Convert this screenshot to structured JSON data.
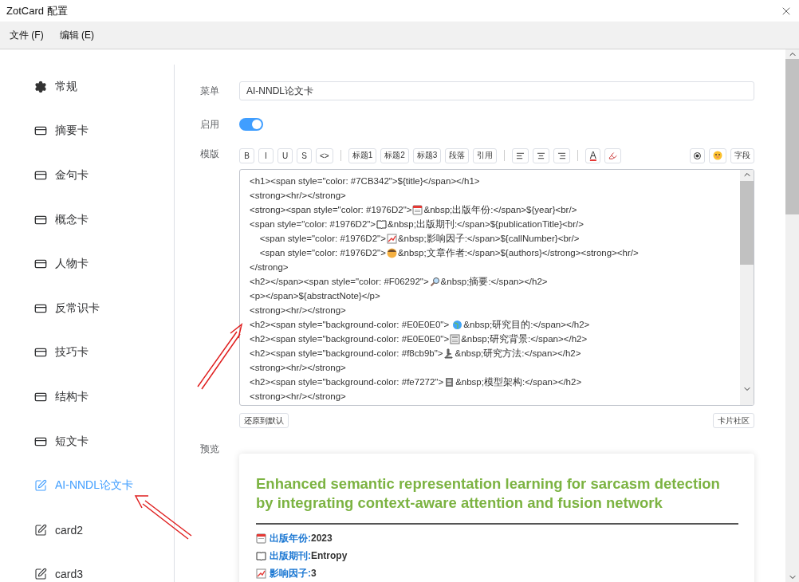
{
  "window": {
    "title": "ZotCard 配置"
  },
  "menu": [
    "文件 (F)",
    "编辑 (E)"
  ],
  "sidebar": {
    "items": [
      {
        "label": "常规",
        "kind": "settings",
        "selected": false
      },
      {
        "label": "摘要卡",
        "kind": "card",
        "selected": false
      },
      {
        "label": "金句卡",
        "kind": "card",
        "selected": false
      },
      {
        "label": "概念卡",
        "kind": "card",
        "selected": false
      },
      {
        "label": "人物卡",
        "kind": "card",
        "selected": false
      },
      {
        "label": "反常识卡",
        "kind": "card",
        "selected": false
      },
      {
        "label": "技巧卡",
        "kind": "card",
        "selected": false
      },
      {
        "label": "结构卡",
        "kind": "card",
        "selected": false
      },
      {
        "label": "短文卡",
        "kind": "card",
        "selected": false
      },
      {
        "label": "AI-NNDL论文卡",
        "kind": "custom",
        "selected": true
      },
      {
        "label": "card2",
        "kind": "custom",
        "selected": false
      },
      {
        "label": "card3",
        "kind": "custom",
        "selected": false
      }
    ]
  },
  "form": {
    "menu_label": "菜单",
    "menu_value": "AI-NNDL论文卡",
    "enabled_label": "启用",
    "enabled": true,
    "template_label": "模版",
    "preview_label": "预览"
  },
  "toolbar": {
    "groups": [
      [
        {
          "kind": "text",
          "label": "B"
        },
        {
          "kind": "text",
          "label": "I"
        },
        {
          "kind": "text",
          "label": "U"
        },
        {
          "kind": "text",
          "label": "S"
        },
        {
          "kind": "text",
          "label": "<>"
        }
      ],
      [
        {
          "kind": "text",
          "label": "标题1"
        },
        {
          "kind": "text",
          "label": "标题2"
        },
        {
          "kind": "text",
          "label": "标题3"
        },
        {
          "kind": "text",
          "label": "段落"
        },
        {
          "kind": "text",
          "label": "引用"
        }
      ],
      [
        {
          "kind": "align-left"
        },
        {
          "kind": "align-center"
        },
        {
          "kind": "align-right"
        }
      ],
      [
        {
          "kind": "color",
          "label": "A"
        },
        {
          "kind": "highlight"
        }
      ]
    ],
    "right": [
      {
        "kind": "record"
      },
      {
        "kind": "emoji"
      },
      {
        "kind": "text",
        "label": "字段"
      }
    ]
  },
  "template_lines": [
    {
      "text": "<h1><span style=\"color: #7CB342\">${title}</span></h1>"
    },
    {
      "text": "<strong><hr/></strong>"
    },
    {
      "before": "<strong><span style=\"color: #1976D2\">",
      "after": "&nbsp;出版年份:</span>${year}<br/>"
    },
    {
      "before": "<span style=\"color: #1976D2\">",
      "after": "&nbsp;出版期刊:</span>${publicationTitle}<br/>"
    },
    {
      "before": "    <span style=\"color: #1976D2\">",
      "after": "&nbsp;影响因子:</span>${callNumber}<br/>"
    },
    {
      "before": "    <span style=\"color: #1976D2\">",
      "after": "&nbsp;文章作者:</span>${authors}</strong><strong><hr/>"
    },
    {
      "text": "</strong>"
    },
    {
      "before": "<h2></span><span style=\"color: #F06292\">",
      "after": "&nbsp;摘要:</span></h2>"
    },
    {
      "text": "<p></span>${abstractNote}</p>"
    },
    {
      "text": "<strong><hr/></strong>"
    },
    {
      "before": "<h2><span style=\"background-color: #E0E0E0\"> ",
      "after": "&nbsp;研究目的:</span></h2>"
    },
    {
      "before": "<h2><span style=\"background-color: #E0E0E0\">",
      "after": "&nbsp;研究背景:</span></h2>"
    },
    {
      "before": "<h2><span style=\"background-color: #f8cb9b\">",
      "after": "&nbsp;研究方法:</span></h2>"
    },
    {
      "text": "<strong><hr/></strong>"
    },
    {
      "before": "<h2><span style=\"background-color: #fe7272\">",
      "after": "&nbsp;模型架构:</span></h2>"
    },
    {
      "text": "<strong><hr/></strong>"
    }
  ],
  "buttons": {
    "reset": "还原到默认",
    "community": "卡片社区"
  },
  "preview": {
    "title": "Enhanced semantic representation learning for sarcasm detection by integrating context-aware attention and fusion network",
    "fields": [
      {
        "label": "出版年份:",
        "value": "2023"
      },
      {
        "label": "出版期刊:",
        "value": "Entropy"
      },
      {
        "label": "影响因子:",
        "value": "3"
      }
    ]
  }
}
